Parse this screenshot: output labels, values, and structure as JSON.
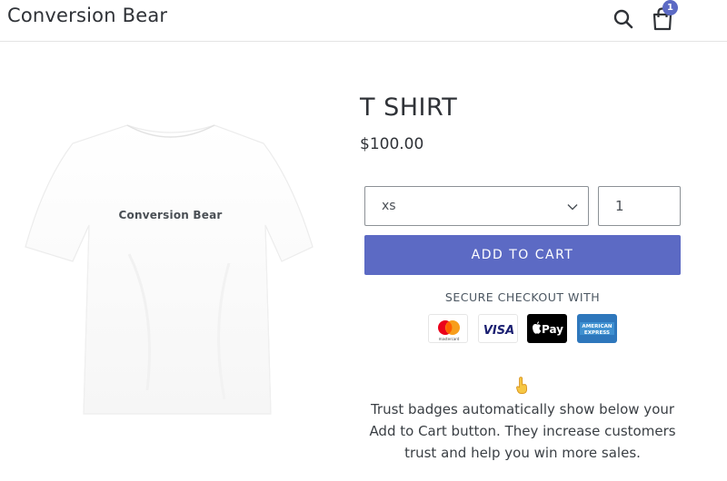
{
  "header": {
    "logo": "Conversion Bear",
    "search_icon": "search-icon",
    "cart_icon": "shopping-bag-icon",
    "cart_count": "1"
  },
  "product": {
    "title": "T SHIRT",
    "price": "$100.00",
    "image_print_text": "Conversion Bear",
    "size_selected": "xs",
    "quantity": "1",
    "add_to_cart_label": "ADD TO CART"
  },
  "trust": {
    "secure_label": "SECURE CHECKOUT WITH",
    "badges": [
      "mastercard-icon",
      "visa-icon",
      "apple-pay-icon",
      "american-express-icon"
    ],
    "badge_text": {
      "mastercard": "mastercard",
      "visa": "VISA",
      "apple_pay": "Pay",
      "amex_line1": "AMERICAN",
      "amex_line2": "EXPRESS"
    },
    "pointer_icon": "pointing-hand-icon",
    "description": "Trust badges automatically show below your Add to Cart button. They increase customers trust and help you win more sales."
  },
  "colors": {
    "accent": "#5c6ac4",
    "text": "#2f3237",
    "border": "#8c9196"
  }
}
